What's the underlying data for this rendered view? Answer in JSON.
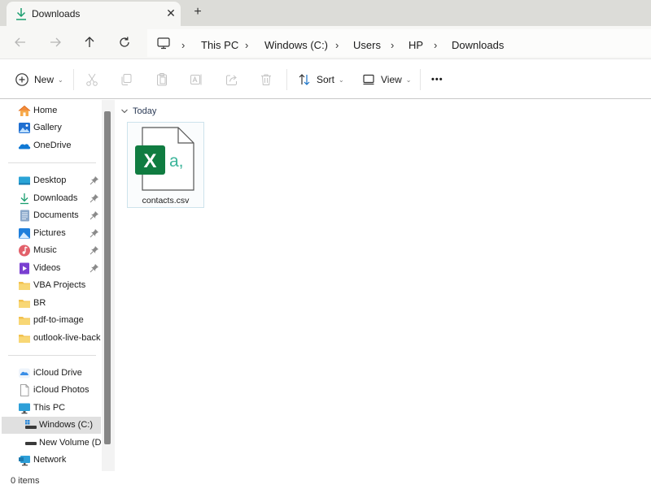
{
  "window": {
    "tab_title": "Downloads",
    "tab_icon": "download-icon",
    "close_tab_glyph": "✕",
    "new_tab_glyph": "+"
  },
  "address": {
    "nav": [
      "back-icon",
      "forward-icon",
      "up-icon",
      "refresh-icon"
    ],
    "root_icon": "monitor-icon",
    "separator": "›",
    "breadcrumbs": [
      "This PC",
      "Windows (C:)",
      "Users",
      "HP",
      "Downloads"
    ]
  },
  "toolbar": {
    "new_label": "New",
    "sort_label": "Sort",
    "view_label": "View",
    "caret": "⌄",
    "more_glyph": "•••",
    "actions": [
      "cut",
      "copy",
      "paste",
      "rename",
      "share",
      "delete"
    ]
  },
  "sidebar": {
    "quick": [
      {
        "label": "Home",
        "icon": "home-icon"
      },
      {
        "label": "Gallery",
        "icon": "gallery-icon"
      },
      {
        "label": "OneDrive",
        "icon": "onedrive-icon"
      }
    ],
    "pinned": [
      {
        "label": "Desktop",
        "icon": "desktop-icon",
        "pinned": true
      },
      {
        "label": "Downloads",
        "icon": "download-icon",
        "pinned": true
      },
      {
        "label": "Documents",
        "icon": "documents-icon",
        "pinned": true
      },
      {
        "label": "Pictures",
        "icon": "pictures-icon",
        "pinned": true
      },
      {
        "label": "Music",
        "icon": "music-icon",
        "pinned": true
      },
      {
        "label": "Videos",
        "icon": "videos-icon",
        "pinned": true
      },
      {
        "label": "VBA Projects",
        "icon": "folder-icon",
        "pinned": false
      },
      {
        "label": "BR",
        "icon": "folder-icon",
        "pinned": false
      },
      {
        "label": "pdf-to-image",
        "icon": "folder-icon",
        "pinned": false
      },
      {
        "label": "outlook-live-back",
        "icon": "folder-icon",
        "pinned": false
      }
    ],
    "drives": [
      {
        "label": "iCloud Drive",
        "icon": "icloud-icon"
      },
      {
        "label": "iCloud Photos",
        "icon": "file-icon"
      },
      {
        "label": "This PC",
        "icon": "this-pc-icon"
      },
      {
        "label": "Windows (C:)",
        "icon": "windows-drive-icon",
        "selected": true
      },
      {
        "label": "New Volume (D:",
        "icon": "drive-icon"
      },
      {
        "label": "Network",
        "icon": "network-icon"
      }
    ]
  },
  "content": {
    "group_label": "Today",
    "files": [
      {
        "name": "contacts.csv",
        "icon": "excel-csv-icon",
        "badge_letter": "X",
        "badge_text": "a,"
      }
    ]
  },
  "status": {
    "item_count": "0 items"
  },
  "colors": {
    "accent_teal": "#1a9e6f",
    "excel_green": "#107c41",
    "csv_text_green": "#3bb49a"
  }
}
